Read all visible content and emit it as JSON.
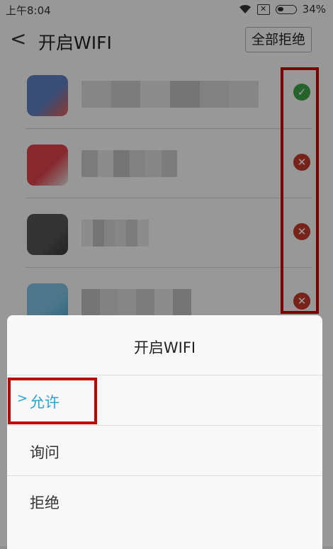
{
  "status_bar": {
    "time": "上午8:04",
    "battery_percent": "34%",
    "battery_level": 0.34
  },
  "header": {
    "title": "开启WIFI",
    "reject_all": "全部拒绝"
  },
  "apps": [
    {
      "status": "allowed",
      "icon_colors": [
        "#5b7fc0",
        "#e35c4d"
      ]
    },
    {
      "status": "denied",
      "icon_colors": [
        "#d9414a",
        "#e0e0e0"
      ]
    },
    {
      "status": "denied",
      "icon_colors": [
        "#555555",
        "#3a3a3a"
      ]
    },
    {
      "status": "denied",
      "icon_colors": [
        "#7fc0e0",
        "#48a6c8"
      ]
    }
  ],
  "sheet": {
    "title": "开启WIFI",
    "options": [
      {
        "label": "允许",
        "selected": true
      },
      {
        "label": "询问",
        "selected": false
      },
      {
        "label": "拒绝",
        "selected": false
      }
    ]
  },
  "colors": {
    "accent": "#2aa4d6",
    "allowed": "#3aa045",
    "denied": "#c0392b",
    "highlight": "#c10000"
  }
}
